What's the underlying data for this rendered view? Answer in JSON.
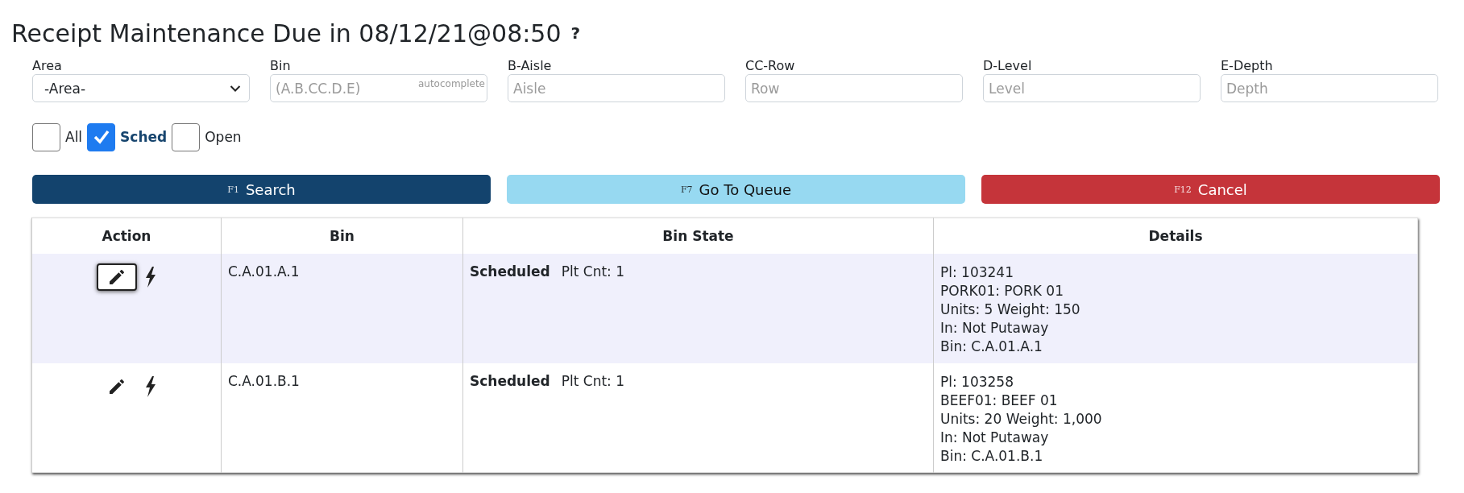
{
  "title": "Receipt Maintenance Due in 08/12/21@08:50",
  "help": "?",
  "fields": [
    {
      "kind": "select",
      "label": "Area",
      "value": "-Area-"
    },
    {
      "kind": "text",
      "label": "Bin",
      "placeholder": "(A.B.CC.D.E)",
      "hint": "autocomplete"
    },
    {
      "kind": "text",
      "label": "B-Aisle",
      "placeholder": "Aisle"
    },
    {
      "kind": "text",
      "label": "CC-Row",
      "placeholder": "Row"
    },
    {
      "kind": "text",
      "label": "D-Level",
      "placeholder": "Level"
    },
    {
      "kind": "text",
      "label": "E-Depth",
      "placeholder": "Depth"
    }
  ],
  "filters": [
    {
      "label": "All",
      "checked": false
    },
    {
      "label": "Sched",
      "checked": true
    },
    {
      "label": "Open",
      "checked": false
    }
  ],
  "buttons": [
    {
      "kind": "primary",
      "key": "F1",
      "label": "Search"
    },
    {
      "kind": "info",
      "key": "F7",
      "label": "Go To Queue"
    },
    {
      "kind": "danger",
      "key": "F12",
      "label": "Cancel"
    }
  ],
  "table": {
    "columns": [
      "Action",
      "Bin",
      "Bin State",
      "Details"
    ],
    "rows": [
      {
        "selected": true,
        "bin": "C.A.01.A.1",
        "state": "Scheduled",
        "count": "Plt Cnt: 1",
        "details": [
          "Pl: 103241",
          "PORK01: PORK 01",
          "Units: 5 Weight: 150",
          "In: Not Putaway",
          "Bin: C.A.01.A.1"
        ]
      },
      {
        "selected": false,
        "bin": "C.A.01.B.1",
        "state": "Scheduled",
        "count": "Plt Cnt: 1",
        "details": [
          "Pl: 103258",
          "BEEF01: BEEF 01",
          "Units: 20 Weight: 1,000",
          "In: Not Putaway",
          "Bin: C.A.01.B.1"
        ]
      }
    ]
  }
}
